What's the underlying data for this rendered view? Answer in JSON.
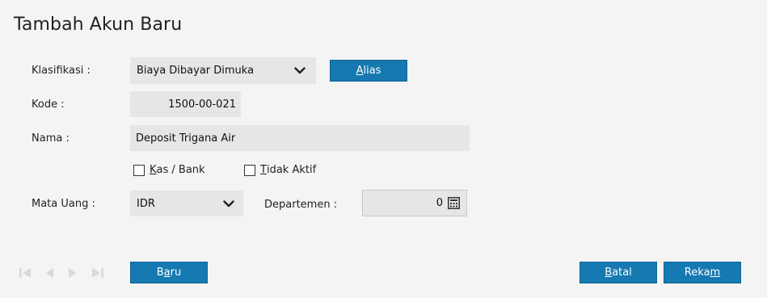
{
  "header": {
    "title": "Tambah Akun Baru"
  },
  "form": {
    "klasifikasi_label": "Klasifikasi :",
    "klasifikasi_value": "Biaya Dibayar Dimuka",
    "alias_pre": "",
    "alias_hotkey": "A",
    "alias_post": "lias",
    "kode_label": "Kode :",
    "kode_value": "1500-00-021",
    "nama_label": "Nama :",
    "nama_value": "Deposit Trigana Air",
    "kas_hotkey": "K",
    "kas_rest": "as / Bank",
    "tidak_hotkey": "T",
    "tidak_rest": "idak Aktif",
    "mata_uang_label": "Mata Uang :",
    "mata_uang_value": "IDR",
    "departemen_label": "Departemen :",
    "departemen_value": "0"
  },
  "footer": {
    "baru_pre": "B",
    "baru_hotkey": "a",
    "baru_post": "ru",
    "batal_hotkey": "B",
    "batal_post": "atal",
    "rekam_pre": "Reka",
    "rekam_hotkey": "m"
  },
  "icons": {
    "nav": [
      "first-record-icon",
      "previous-record-icon",
      "next-record-icon",
      "last-record-icon"
    ],
    "chevron": "chevron-down-icon",
    "calculator": "calculator-icon"
  },
  "colors": {
    "accent": "#1679b1",
    "field_bg": "#e6e6e6",
    "page_bg": "#f4f4f4",
    "nav_disabled": "#d9d9d9"
  }
}
